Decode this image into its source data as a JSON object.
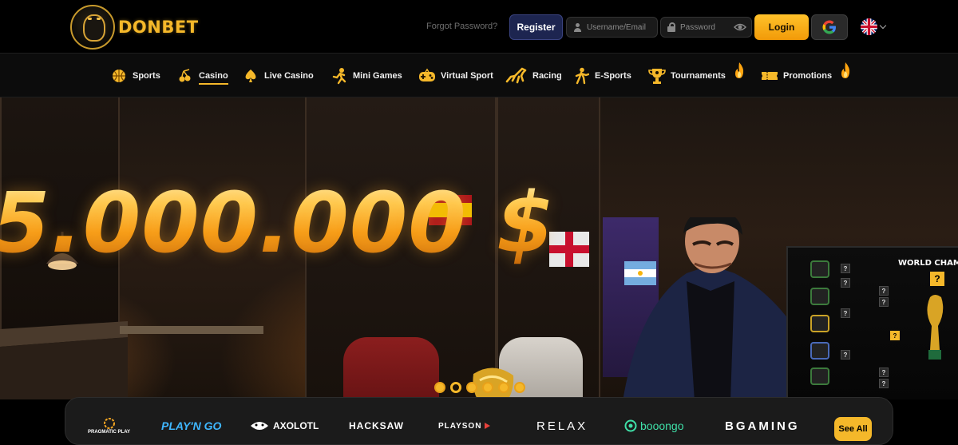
{
  "brand": {
    "name": "DONBET",
    "accent": "#f5b82a"
  },
  "auth": {
    "forgot_password": "Forgot Password?",
    "register_label": "Register",
    "username_placeholder": "Username/Email",
    "password_placeholder": "Password",
    "login_label": "Login",
    "google_icon": "google-icon",
    "language_icon": "uk-flag-icon"
  },
  "nav": {
    "items": [
      {
        "label": "Sports",
        "icon": "basketball-icon",
        "active": false
      },
      {
        "label": "Casino",
        "icon": "cherry-icon",
        "active": true
      },
      {
        "label": "Live Casino",
        "icon": "spade-icon",
        "active": false
      },
      {
        "label": "Mini Games",
        "icon": "figure-icon",
        "active": false
      },
      {
        "label": "Virtual Sport",
        "icon": "gamepad-icon",
        "active": false
      },
      {
        "label": "Racing",
        "icon": "horse-icon",
        "active": false
      },
      {
        "label": "E-Sports",
        "icon": "soldier-icon",
        "active": false
      },
      {
        "label": "Tournaments",
        "icon": "trophy-icon",
        "hot": true,
        "active": false
      },
      {
        "label": "Promotions",
        "icon": "ticket-icon",
        "hot": true,
        "active": false
      }
    ]
  },
  "hero": {
    "jackpot": "5.000.000 $",
    "bracket_title": "WORLD CHAMP",
    "slides_count": 6,
    "active_slide": 2
  },
  "providers": {
    "items": [
      {
        "name": "PRAGMATIC PLAY"
      },
      {
        "name": "PLAY'N GO"
      },
      {
        "name": "AXOLOTL"
      },
      {
        "name": "HACKSAW"
      },
      {
        "name": "PLAYSON"
      },
      {
        "name": "RELAX"
      },
      {
        "name": "booongo"
      },
      {
        "name": "BGAMING"
      }
    ],
    "see_all": "See All"
  }
}
